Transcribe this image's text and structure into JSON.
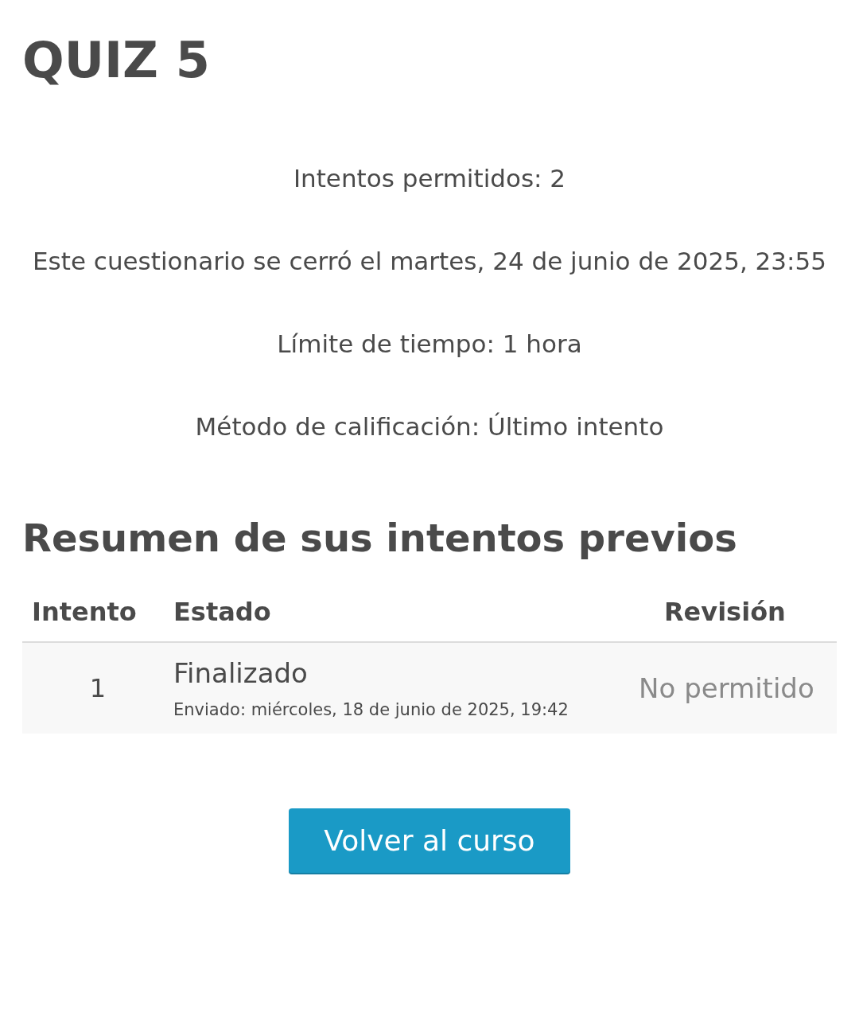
{
  "title": "QUIZ 5",
  "info": [
    "Intentos permitidos: 2",
    "Este cuestionario se cerró el martes, 24 de junio de 2025, 23:55",
    "Límite de tiempo: 1 hora",
    "Método de calificación: Último intento"
  ],
  "summary": {
    "heading": "Resumen de sus intentos previos",
    "columns": [
      "Intento",
      "Estado",
      "Revisión"
    ],
    "rows": [
      {
        "attempt": "1",
        "state": "Finalizado",
        "submitted": "Enviado: miércoles, 18 de junio de 2025, 19:42",
        "review": "No permitido"
      }
    ]
  },
  "button": "Volver al curso"
}
